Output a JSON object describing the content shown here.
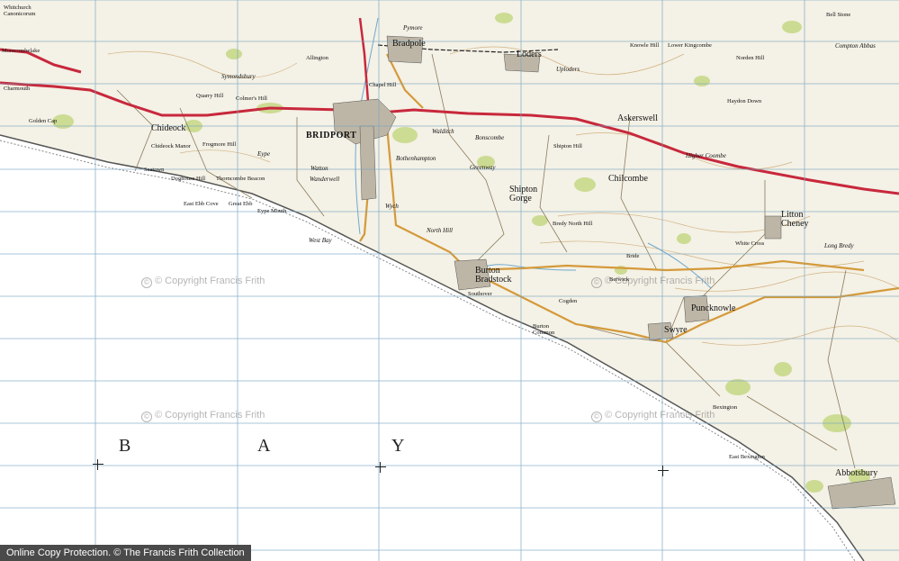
{
  "bay_letters": [
    "B",
    "A",
    "Y"
  ],
  "towns": [
    {
      "name": "BRIDPORT"
    },
    {
      "name": "Askerswell"
    },
    {
      "name": "Puncknowle"
    },
    {
      "name": "Swyre"
    },
    {
      "name": "Burton Bradstock"
    },
    {
      "name": "Shipton Gorge"
    },
    {
      "name": "Litton Cheney"
    },
    {
      "name": "Chilcombe"
    },
    {
      "name": "Loders"
    },
    {
      "name": "Bradpole"
    },
    {
      "name": "Abbotsbury"
    },
    {
      "name": "Chideock"
    },
    {
      "name": "West Bay"
    },
    {
      "name": "Walditch"
    }
  ],
  "hamlets": [
    {
      "name": "Whitchurch Canonicorum"
    },
    {
      "name": "Symondsbury"
    },
    {
      "name": "Allington"
    },
    {
      "name": "Pymore"
    },
    {
      "name": "Uploders"
    },
    {
      "name": "Eype"
    },
    {
      "name": "Watton"
    },
    {
      "name": "Wanderwell"
    },
    {
      "name": "Bothenhampton"
    },
    {
      "name": "Bonscombe"
    },
    {
      "name": "Greenway"
    },
    {
      "name": "North Hill"
    },
    {
      "name": "Berwick"
    },
    {
      "name": "Bride"
    },
    {
      "name": "Cogden"
    },
    {
      "name": "Burton Common"
    },
    {
      "name": "Southover"
    },
    {
      "name": "Bredy North Hill"
    },
    {
      "name": "Haydon Down"
    },
    {
      "name": "Higher Coombe"
    },
    {
      "name": "White Cross"
    },
    {
      "name": "Long Bredy"
    },
    {
      "name": "Compton Abbas"
    },
    {
      "name": "Bexington"
    },
    {
      "name": "East Bexington"
    },
    {
      "name": "Seatown"
    },
    {
      "name": "Golden Cap"
    },
    {
      "name": "Charmouth"
    },
    {
      "name": "Morecombelake"
    },
    {
      "name": "Chideock Manor"
    },
    {
      "name": "Quarry Hill"
    },
    {
      "name": "Colmer's Hill"
    },
    {
      "name": "Frogmore Hill"
    },
    {
      "name": "Thorncombe Beacon"
    },
    {
      "name": "Doghouse Hill"
    },
    {
      "name": "East Ebb Cove"
    },
    {
      "name": "Great Ebb"
    },
    {
      "name": "Eype Mouth"
    },
    {
      "name": "Wych"
    },
    {
      "name": "Chapel Hill"
    },
    {
      "name": "Shipton Hill"
    },
    {
      "name": "Lower Kingcombe"
    },
    {
      "name": "Bell Stone"
    },
    {
      "name": "Knowle Hill"
    },
    {
      "name": "Norden Hill"
    }
  ],
  "watermarks": [
    "© Copyright Francis Frith",
    "© Copyright Francis Frith",
    "© Copyright Francis Frith",
    "© Copyright Francis Frith"
  ],
  "footer": "Online Copy Protection.  © The Francis Frith Collection",
  "colors": {
    "land": "#f4f1e6",
    "sea": "#ffffff",
    "main_road": "#c8283c",
    "b_road": "#d49a3a",
    "woodland": "#c8d98a",
    "grid": "#7aa6c2",
    "contour": "#c9a46a",
    "town": "#bdb6a6",
    "stream": "#6fa9cf"
  },
  "icons": [
    "grid-crosshair-icon",
    "copyright-icon"
  ]
}
